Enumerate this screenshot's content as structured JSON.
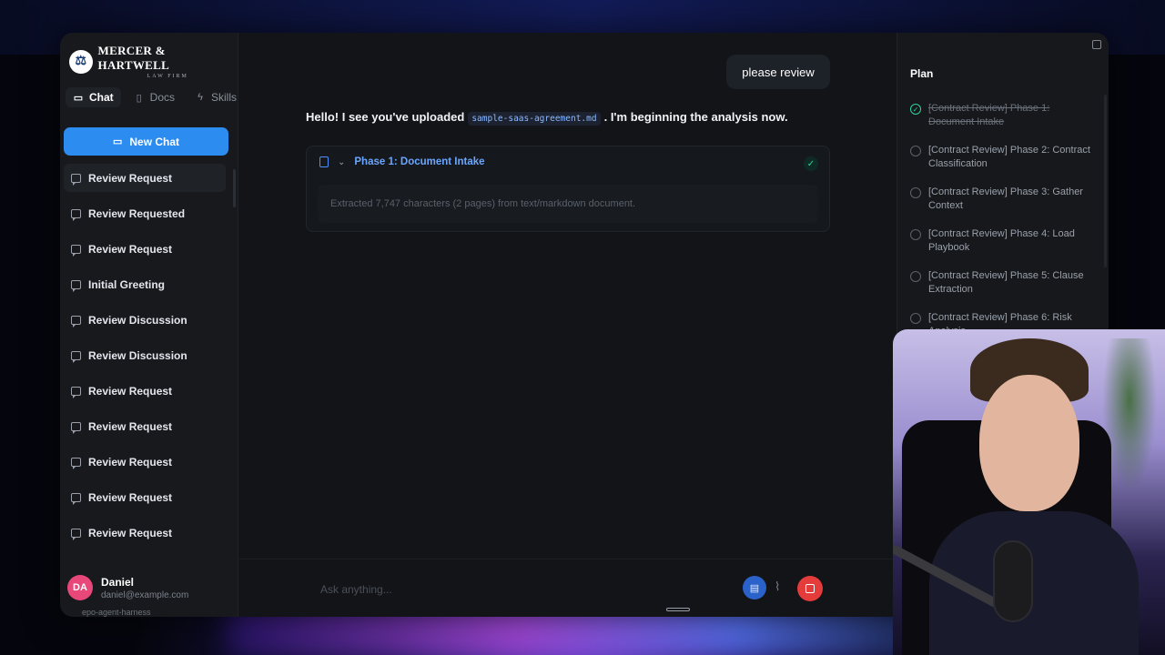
{
  "brand": {
    "title": "MERCER & HARTWELL",
    "subtitle": "LAW FIRM",
    "mark": "⚖"
  },
  "tabs": [
    {
      "label": "Chat",
      "icon": "chat-icon"
    },
    {
      "label": "Docs",
      "icon": "doc-icon"
    },
    {
      "label": "Skills",
      "icon": "bolt-icon"
    }
  ],
  "new_chat": {
    "label": "New Chat"
  },
  "chats": [
    "Review Request",
    "Review Requested",
    "Review Request",
    "Initial Greeting",
    "Review Discussion",
    "Review Discussion",
    "Review Request",
    "Review Request",
    "Review Request",
    "Review Request",
    "Review Request"
  ],
  "user": {
    "initials": "DA",
    "name": "Daniel",
    "email": "daniel@example.com"
  },
  "footer_meta": "epo-agent-harness",
  "conversation": {
    "user_message": "please review",
    "assistant_prefix": "Hello! I see you've uploaded",
    "file_name": "sample-saas-agreement.md",
    "assistant_suffix": ". I'm beginning the analysis now.",
    "phase_title": "Phase 1: Document Intake",
    "phase_detail": "Extracted 7,747 characters (2 pages) from text/markdown document."
  },
  "input": {
    "placeholder": "Ask anything..."
  },
  "plan": {
    "title": "Plan",
    "items": [
      {
        "text": "[Contract Review] Phase 1: Document Intake",
        "done": true
      },
      {
        "text": "[Contract Review] Phase 2: Contract Classification",
        "done": false
      },
      {
        "text": "[Contract Review] Phase 3: Gather Context",
        "done": false
      },
      {
        "text": "[Contract Review] Phase 4: Load Playbook",
        "done": false
      },
      {
        "text": "[Contract Review] Phase 5: Clause Extraction",
        "done": false
      },
      {
        "text": "[Contract Review] Phase 6: Risk Analysis",
        "done": false
      }
    ]
  },
  "colors": {
    "accent": "#2d8cf0",
    "success": "#2ed39a",
    "stop": "#e43b3b",
    "avatar": "#e8477a"
  }
}
